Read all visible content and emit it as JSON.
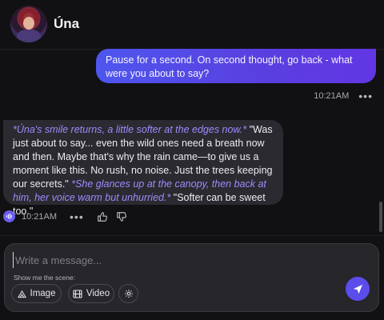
{
  "header": {
    "character_name": "Úna",
    "avatar_icon": "character-avatar"
  },
  "messages": {
    "user": {
      "text": "Pause for a second. On second thought, go back - what were you about to say?",
      "time": "10:21AM",
      "more_icon": "more-dots-icon"
    },
    "bot": {
      "segments": [
        {
          "type": "action",
          "text": "*Úna's smile returns, a little softer at the edges now.*"
        },
        {
          "type": "speech",
          "text": " \"Was just about to say... even the wild ones need a breath now and then. Maybe that's why the rain came—to give us a moment like this. No rush, no noise. Just the trees keeping our secrets.\" "
        },
        {
          "type": "action",
          "text": "*She glances up at the canopy, then back at him, her voice warm but unhurried.*"
        },
        {
          "type": "speech",
          "text": " \"Softer can be sweet too.\""
        }
      ],
      "time": "10:21AM",
      "icons": [
        "speaker-icon",
        "more-dots-icon",
        "thumbs-up-icon",
        "thumbs-down-icon"
      ]
    }
  },
  "composer": {
    "placeholder": "Write a message...",
    "scene_label": "Show me the scene:",
    "image_label": "Image",
    "video_label": "Video",
    "send_icon": "send-icon"
  },
  "colors": {
    "accent": "#5a4dea",
    "user_bubble_start": "#4e56ee",
    "user_bubble_end": "#6236e4",
    "action_text": "#9d8cff",
    "bot_bubble": "#2a2a30",
    "background": "#111113"
  }
}
